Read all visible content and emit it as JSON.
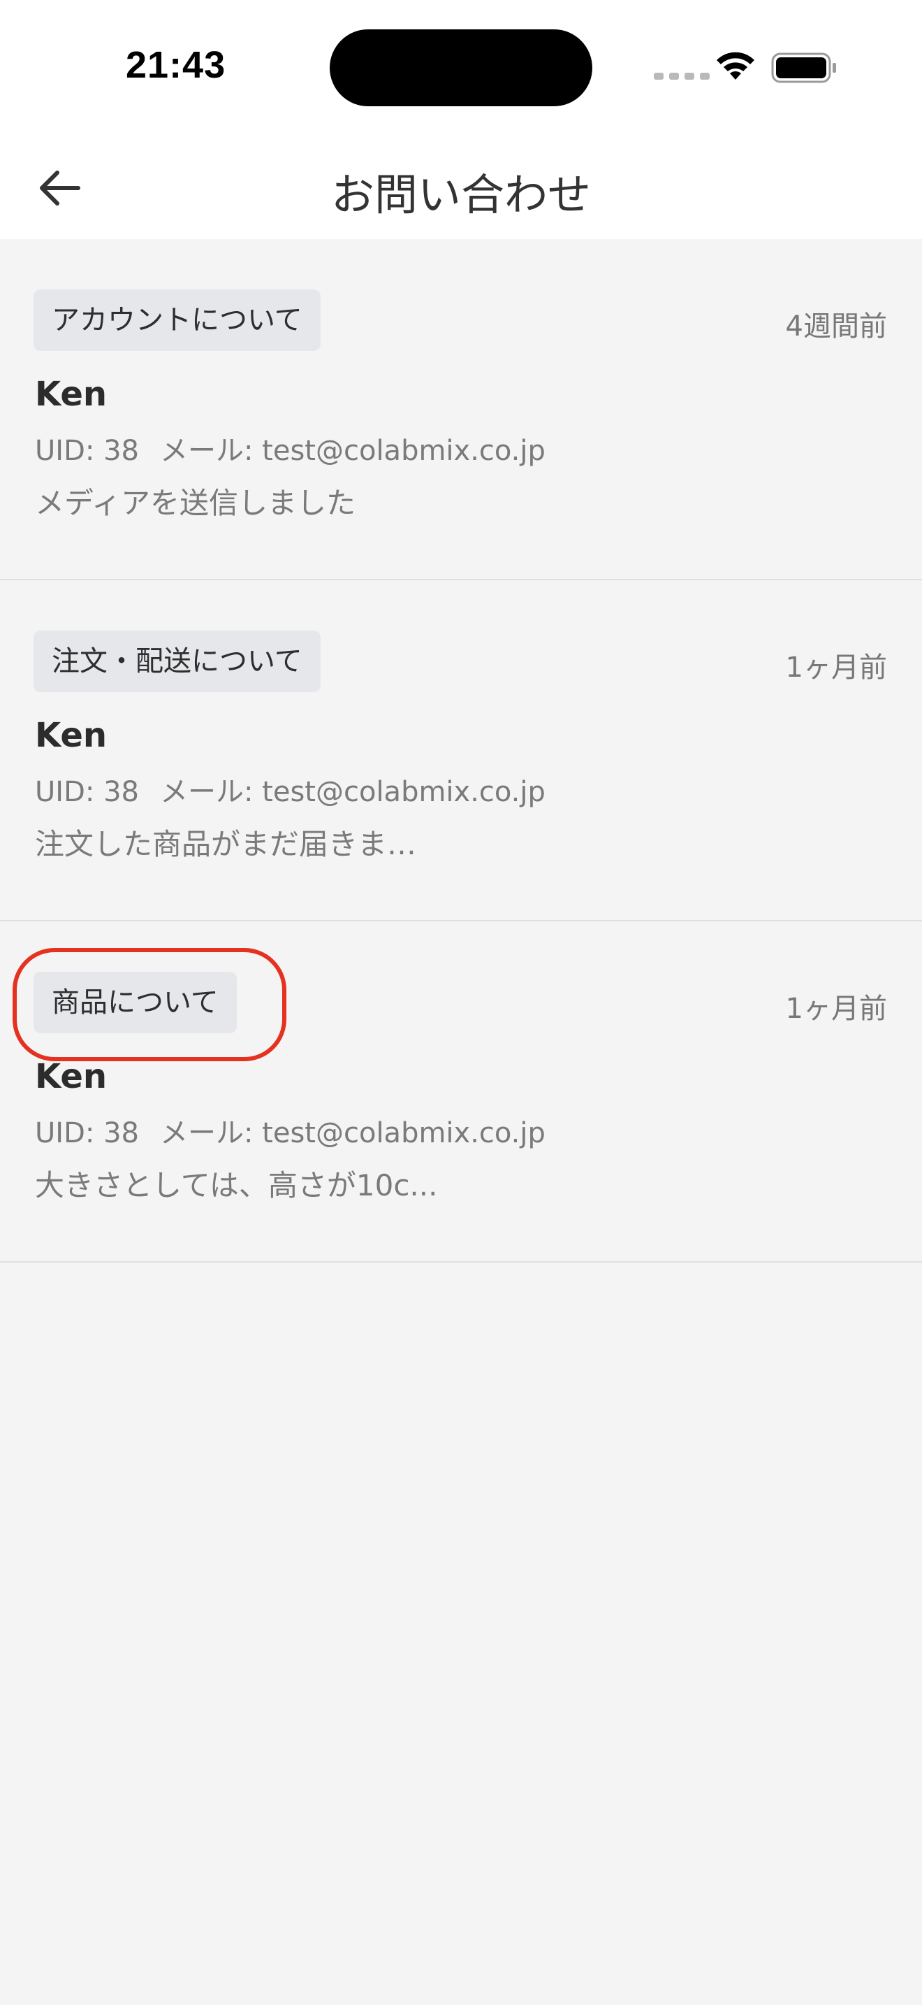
{
  "status_bar": {
    "time": "21:43"
  },
  "header": {
    "title": "お問い合わせ",
    "back_icon": "arrow-left-icon"
  },
  "inquiries": [
    {
      "category": "アカウントについて",
      "time_ago": "4週間前",
      "name": "Ken",
      "uid": "UID: 38",
      "email": "メール: test@colabmix.co.jp",
      "preview": "メディアを送信しました"
    },
    {
      "category": "注文・配送について",
      "time_ago": "1ヶ月前",
      "name": "Ken",
      "uid": "UID: 38",
      "email": "メール: test@colabmix.co.jp",
      "preview": "注文した商品がまだ届きま…"
    },
    {
      "category": "商品について",
      "time_ago": "1ヶ月前",
      "name": "Ken",
      "uid": "UID: 38",
      "email": "メール: test@colabmix.co.jp",
      "preview": "大きさとしては、高さが10c..."
    }
  ],
  "colors": {
    "highlight": "#e5311f",
    "tag_bg": "#e6e7ea",
    "page_bg": "#f4f4f4"
  }
}
